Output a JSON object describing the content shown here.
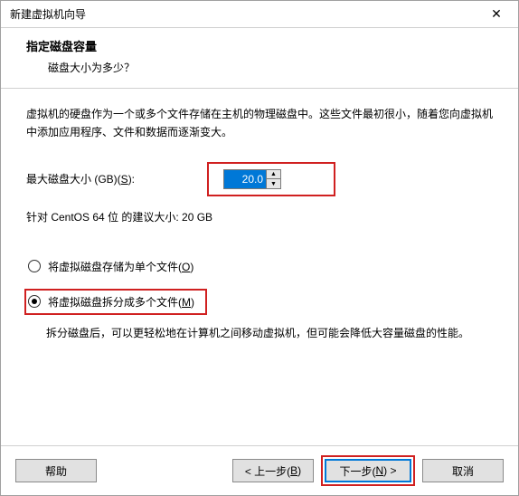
{
  "window": {
    "title": "新建虚拟机向导"
  },
  "header": {
    "title": "指定磁盘容量",
    "subtitle": "磁盘大小为多少？"
  },
  "content": {
    "description": "虚拟机的硬盘作为一个或多个文件存储在主机的物理磁盘中。这些文件最初很小，随着您向虚拟机中添加应用程序、文件和数据而逐渐变大。",
    "sizeLabelPrefix": "最大磁盘大小 (GB)(",
    "sizeLabelKey": "S",
    "sizeLabelSuffix": "):",
    "sizeValue": "20.0",
    "recommend": "针对 CentOS 64 位 的建议大小: 20 GB",
    "radio1Prefix": "将虚拟磁盘存储为单个文件(",
    "radio1Key": "O",
    "radio1Suffix": ")",
    "radio2Prefix": "将虚拟磁盘拆分成多个文件(",
    "radio2Key": "M",
    "radio2Suffix": ")",
    "radio2Desc": "拆分磁盘后，可以更轻松地在计算机之间移动虚拟机，但可能会降低大容量磁盘的性能。"
  },
  "footer": {
    "help": "帮助",
    "backPrefix": "< 上一步(",
    "backKey": "B",
    "backSuffix": ")",
    "nextPrefix": "下一步(",
    "nextKey": "N",
    "nextSuffix": ") >",
    "cancel": "取消"
  }
}
